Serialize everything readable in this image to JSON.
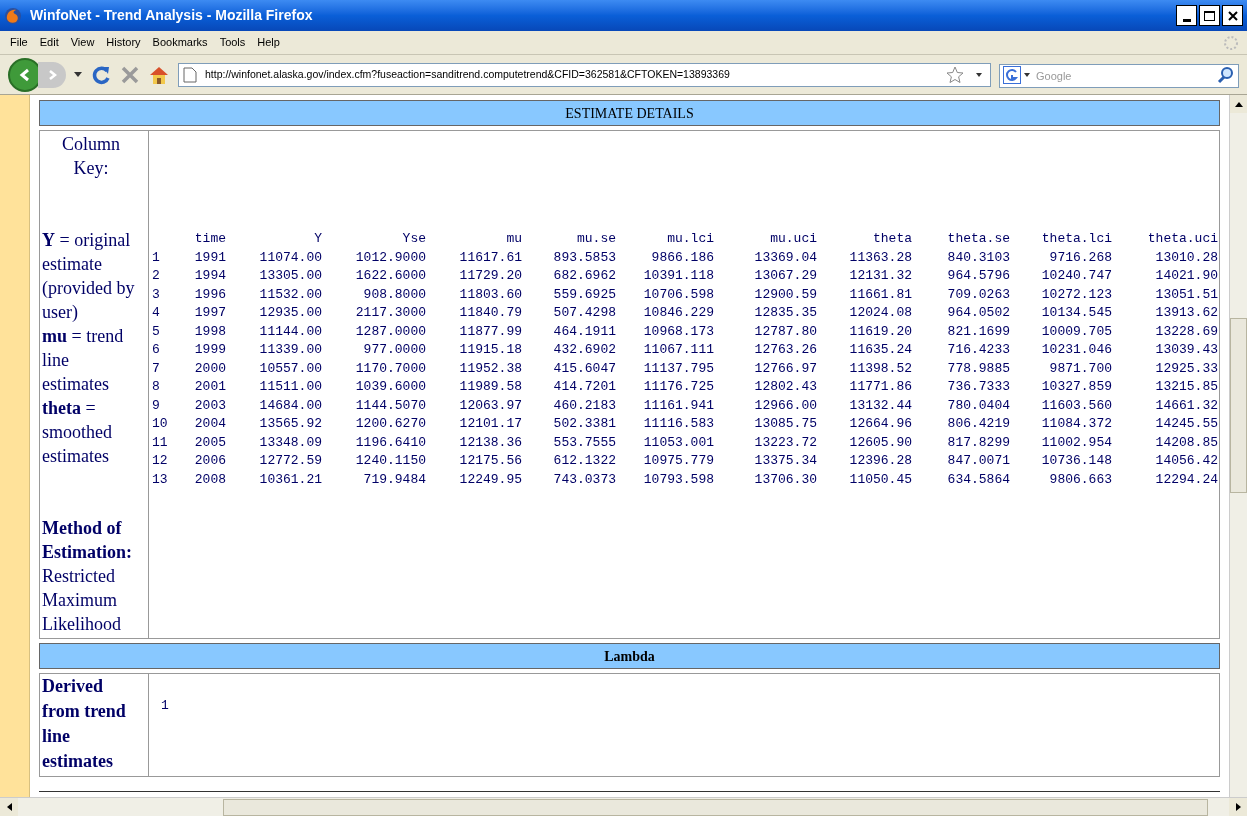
{
  "window": {
    "title": "WinfoNet - Trend Analysis - Mozilla Firefox"
  },
  "menu": [
    "File",
    "Edit",
    "View",
    "History",
    "Bookmarks",
    "Tools",
    "Help"
  ],
  "address": {
    "value": "http://winfonet.alaska.gov/index.cfm?fuseaction=sanditrend.computetrend&CFID=362581&CFTOKEN=13893369"
  },
  "search": {
    "placeholder": "Google"
  },
  "estimate_details": {
    "title": "ESTIMATE DETAILS",
    "key_title": "Column Key:",
    "key_items": [
      "**Y** = original estimate (provided by user)",
      "**mu** = trend line estimates",
      "**theta** = smoothed estimates"
    ],
    "method_label": "Method of Estimation:",
    "method_value": "Restricted Maximum Likelihood",
    "table": {
      "columns": [
        "",
        "time",
        "Y",
        "Yse",
        "mu",
        "mu.se",
        "mu.lci",
        "mu.uci",
        "theta",
        "theta.se",
        "theta.lci",
        "theta.uci"
      ],
      "rows": [
        [
          "1",
          "1991",
          "11074.00",
          "1012.9000",
          "11617.61",
          "893.5853",
          "9866.186",
          "13369.04",
          "11363.28",
          "840.3103",
          "9716.268",
          "13010.28"
        ],
        [
          "2",
          "1994",
          "13305.00",
          "1622.6000",
          "11729.20",
          "682.6962",
          "10391.118",
          "13067.29",
          "12131.32",
          "964.5796",
          "10240.747",
          "14021.90"
        ],
        [
          "3",
          "1996",
          "11532.00",
          "908.8000",
          "11803.60",
          "559.6925",
          "10706.598",
          "12900.59",
          "11661.81",
          "709.0263",
          "10272.123",
          "13051.51"
        ],
        [
          "4",
          "1997",
          "12935.00",
          "2117.3000",
          "11840.79",
          "507.4298",
          "10846.229",
          "12835.35",
          "12024.08",
          "964.0502",
          "10134.545",
          "13913.62"
        ],
        [
          "5",
          "1998",
          "11144.00",
          "1287.0000",
          "11877.99",
          "464.1911",
          "10968.173",
          "12787.80",
          "11619.20",
          "821.1699",
          "10009.705",
          "13228.69"
        ],
        [
          "6",
          "1999",
          "11339.00",
          "977.0000",
          "11915.18",
          "432.6902",
          "11067.111",
          "12763.26",
          "11635.24",
          "716.4233",
          "10231.046",
          "13039.43"
        ],
        [
          "7",
          "2000",
          "10557.00",
          "1170.7000",
          "11952.38",
          "415.6047",
          "11137.795",
          "12766.97",
          "11398.52",
          "778.9885",
          "9871.700",
          "12925.33"
        ],
        [
          "8",
          "2001",
          "11511.00",
          "1039.6000",
          "11989.58",
          "414.7201",
          "11176.725",
          "12802.43",
          "11771.86",
          "736.7333",
          "10327.859",
          "13215.85"
        ],
        [
          "9",
          "2003",
          "14684.00",
          "1144.5070",
          "12063.97",
          "460.2183",
          "11161.941",
          "12966.00",
          "13132.44",
          "780.0404",
          "11603.560",
          "14661.32"
        ],
        [
          "10",
          "2004",
          "13565.92",
          "1200.6270",
          "12101.17",
          "502.3381",
          "11116.583",
          "13085.75",
          "12664.96",
          "806.4219",
          "11084.372",
          "14245.55"
        ],
        [
          "11",
          "2005",
          "13348.09",
          "1196.6410",
          "12138.36",
          "553.7555",
          "11053.001",
          "13223.72",
          "12605.90",
          "817.8299",
          "11002.954",
          "14208.85"
        ],
        [
          "12",
          "2006",
          "12772.59",
          "1240.1150",
          "12175.56",
          "612.1322",
          "10975.779",
          "13375.34",
          "12396.28",
          "847.0071",
          "10736.148",
          "14056.42"
        ],
        [
          "13",
          "2008",
          "10361.21",
          "719.9484",
          "12249.95",
          "743.0373",
          "10793.598",
          "13706.30",
          "11050.45",
          "634.5864",
          "9806.663",
          "12294.24"
        ]
      ]
    }
  },
  "lambda": {
    "title": "Lambda",
    "label": "Derived from trend line estimates",
    "value": "1"
  }
}
